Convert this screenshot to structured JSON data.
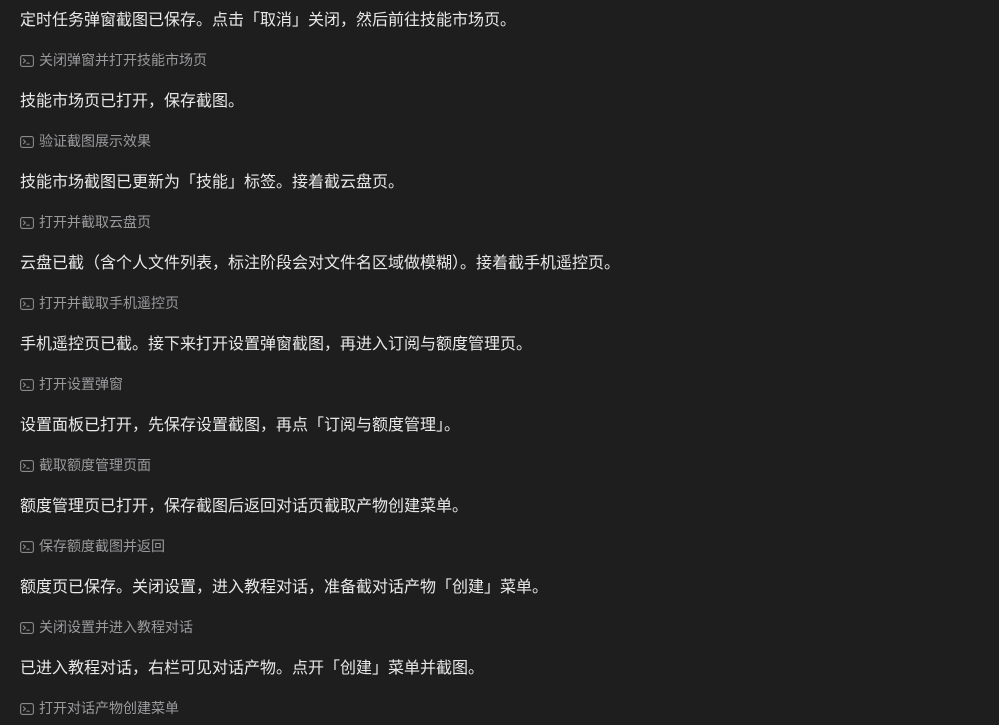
{
  "entries": [
    {
      "type": "message",
      "text": "定时任务弹窗截图已保存。点击「取消」关闭，然后前往技能市场页。"
    },
    {
      "type": "tool",
      "icon": "terminal-icon",
      "text": "关闭弹窗并打开技能市场页"
    },
    {
      "type": "message",
      "text": "技能市场页已打开，保存截图。"
    },
    {
      "type": "tool",
      "icon": "terminal-icon",
      "text": "验证截图展示效果"
    },
    {
      "type": "message",
      "text": "技能市场截图已更新为「技能」标签。接着截云盘页。"
    },
    {
      "type": "tool",
      "icon": "terminal-icon",
      "text": "打开并截取云盘页"
    },
    {
      "type": "message",
      "text": "云盘已截（含个人文件列表，标注阶段会对文件名区域做模糊）。接着截手机遥控页。"
    },
    {
      "type": "tool",
      "icon": "terminal-icon",
      "text": "打开并截取手机遥控页"
    },
    {
      "type": "message",
      "text": "手机遥控页已截。接下来打开设置弹窗截图，再进入订阅与额度管理页。"
    },
    {
      "type": "tool",
      "icon": "terminal-icon",
      "text": "打开设置弹窗"
    },
    {
      "type": "message",
      "text": "设置面板已打开，先保存设置截图，再点「订阅与额度管理」。"
    },
    {
      "type": "tool",
      "icon": "terminal-icon",
      "text": "截取额度管理页面"
    },
    {
      "type": "message",
      "text": "额度管理页已打开，保存截图后返回对话页截取产物创建菜单。"
    },
    {
      "type": "tool",
      "icon": "terminal-icon",
      "text": "保存额度截图并返回"
    },
    {
      "type": "message",
      "text": "额度页已保存。关闭设置，进入教程对话，准备截对话产物「创建」菜单。"
    },
    {
      "type": "tool",
      "icon": "terminal-icon",
      "text": "关闭设置并进入教程对话"
    },
    {
      "type": "message",
      "text": "已进入教程对话，右栏可见对话产物。点开「创建」菜单并截图。"
    },
    {
      "type": "tool",
      "icon": "terminal-icon",
      "text": "打开对话产物创建菜单"
    }
  ]
}
